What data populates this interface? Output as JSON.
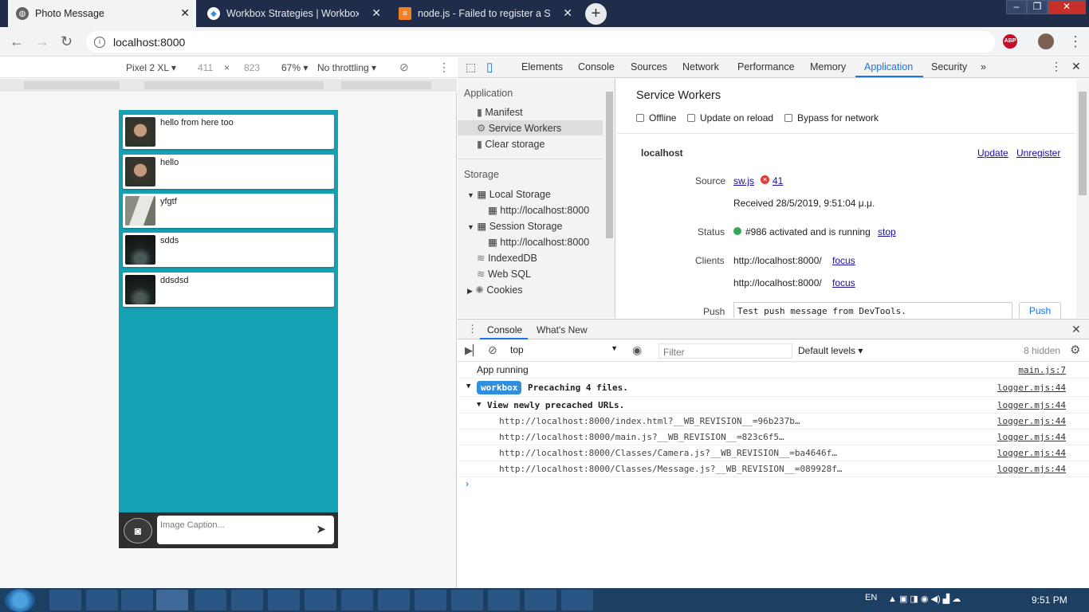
{
  "browser": {
    "tabs": [
      {
        "title": "Photo Message",
        "active": true,
        "icon": "globe-icon"
      },
      {
        "title": "Workbox Strategies  |  Workbox",
        "active": false,
        "icon": "workbox-icon"
      },
      {
        "title": "node.js - Failed to register a Serv",
        "active": false,
        "icon": "stackoverflow-icon"
      }
    ],
    "url": "localhost:8000",
    "abp": "ABP"
  },
  "device": {
    "name": "Pixel 2 XL",
    "width": "411",
    "x": "×",
    "height": "823",
    "zoom": "67%",
    "throttle": "No throttling"
  },
  "phone": {
    "messages": [
      {
        "text": "hello from here too"
      },
      {
        "text": "hello"
      },
      {
        "text": "yfgtf"
      },
      {
        "text": "sdds"
      },
      {
        "text": "ddsdsd"
      }
    ],
    "caption_placeholder": "Image Caption..."
  },
  "devtools": {
    "tabs": [
      "Elements",
      "Console",
      "Sources",
      "Network",
      "Performance",
      "Memory",
      "Application",
      "Security"
    ],
    "active_tab": "Application",
    "sidebar": {
      "app_header": "Application",
      "manifest": "Manifest",
      "service_workers": "Service Workers",
      "clear_storage": "Clear storage",
      "storage_header": "Storage",
      "local_storage": "Local Storage",
      "local_origin": "http://localhost:8000",
      "session_storage": "Session Storage",
      "session_origin": "http://localhost:8000",
      "indexeddb": "IndexedDB",
      "websql": "Web SQL",
      "cookies": "Cookies"
    },
    "sw": {
      "title": "Service Workers",
      "offline": "Offline",
      "update_on_reload": "Update on reload",
      "bypass": "Bypass for network",
      "origin": "localhost",
      "update": "Update",
      "unregister": "Unregister",
      "source_label": "Source",
      "source_file": "sw.js",
      "error_count": "41",
      "received": "Received 28/5/2019, 9:51:04 μ.μ.",
      "status_label": "Status",
      "status_text": "#986 activated and is running",
      "stop": "stop",
      "clients_label": "Clients",
      "client1": "http://localhost:8000/",
      "client2": "http://localhost:8000/",
      "focus": "focus",
      "push_label": "Push",
      "push_value": "Test push message from DevTools.",
      "push_button": "Push"
    },
    "console": {
      "tabs": [
        "Console",
        "What's New"
      ],
      "context": "top",
      "filter_placeholder": "Filter",
      "levels": "Default levels",
      "hidden": "8 hidden",
      "lines": [
        {
          "text": "App running",
          "src": "main.js:7"
        },
        {
          "badge": "workbox",
          "text": "Precaching 4 files.",
          "src": "logger.mjs:44"
        },
        {
          "text": "View newly precached URLs.",
          "src": "logger.mjs:44"
        },
        {
          "text": "http://localhost:8000/index.html?__WB_REVISION__=96b237b…",
          "src": "logger.mjs:44"
        },
        {
          "text": "http://localhost:8000/main.js?__WB_REVISION__=823c6f5…",
          "src": "logger.mjs:44"
        },
        {
          "text": "http://localhost:8000/Classes/Camera.js?__WB_REVISION__=ba4646f…",
          "src": "logger.mjs:44"
        },
        {
          "text": "http://localhost:8000/Classes/Message.js?__WB_REVISION__=089928f…",
          "src": "logger.mjs:44"
        }
      ]
    }
  },
  "taskbar": {
    "lang": "EN",
    "time": "9:51 PM"
  },
  "colors": {
    "accent": "#1a73e8",
    "phone_bg": "#17a1b5",
    "taskbar": "#1d3f62",
    "workbox_badge": "#2f8ede"
  }
}
